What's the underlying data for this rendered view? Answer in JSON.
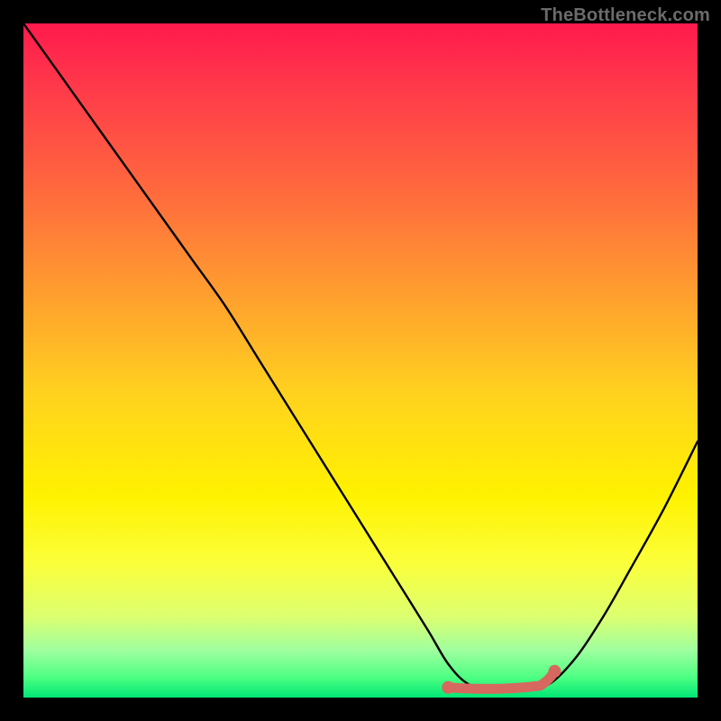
{
  "attribution": "TheBottleneck.com",
  "colors": {
    "background": "#000000",
    "gradient_top": "#ff1a4d",
    "gradient_mid": "#fff200",
    "gradient_bottom": "#00e676",
    "curve": "#000000",
    "flat_marker": "#d6685f"
  },
  "chart_data": {
    "type": "line",
    "title": "",
    "xlabel": "",
    "ylabel": "",
    "xlim": [
      0,
      100
    ],
    "ylim": [
      0,
      100
    ],
    "series": [
      {
        "name": "bottleneck-curve",
        "x": [
          0,
          5,
          10,
          15,
          20,
          25,
          30,
          35,
          40,
          45,
          50,
          55,
          60,
          63,
          66,
          70,
          74,
          78,
          82,
          86,
          90,
          95,
          100
        ],
        "values": [
          100,
          93,
          86,
          79,
          72,
          65,
          58,
          50,
          42,
          34,
          26,
          18,
          10,
          5,
          2,
          1,
          1,
          2,
          6,
          12,
          19,
          28,
          38
        ]
      }
    ],
    "flat_region": {
      "x_start": 63,
      "x_end": 78,
      "y": 1.5
    },
    "annotations": []
  }
}
